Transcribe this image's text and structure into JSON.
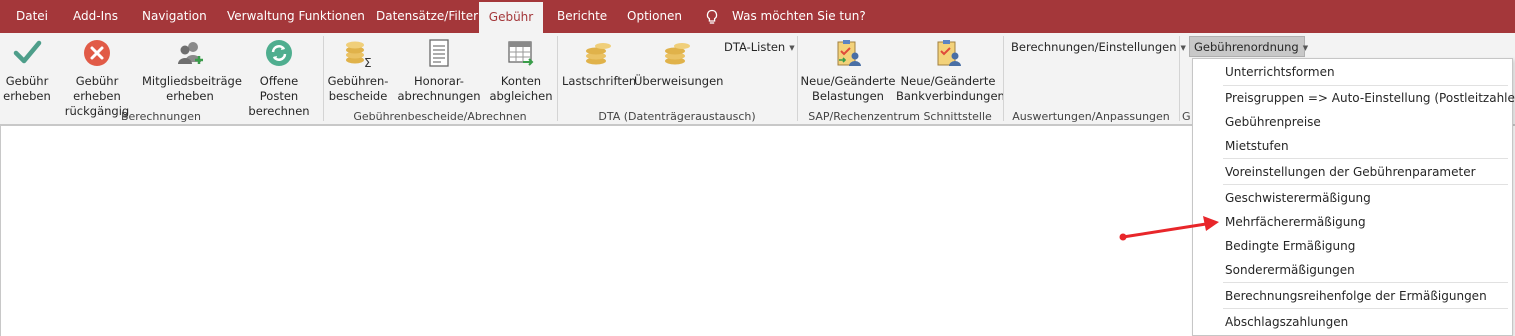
{
  "tabs": [
    "Datei",
    "Add-Ins",
    "Navigation",
    "Verwaltung Funktionen",
    "Datensätze/Filter",
    "Gebühr",
    "Berichte",
    "Optionen"
  ],
  "active_tab": "Gebühr",
  "tell_me": "Was möchten Sie tun?",
  "ribbon": {
    "buttons": {
      "gebuehr_erheben": "Gebühr\nerheben",
      "gebuehr_rueckgaengig": "Gebühr erheben\nrückgängig",
      "mitgliedsbeitraege": "Mitgliedsbeiträge\nerheben",
      "offene_posten": "Offene Posten\nberechnen",
      "gebuehrenbescheide": "Gebühren-\nbescheide",
      "honorarabrechnungen": "Honorar-\nabrechnungen",
      "konten_abgleichen": "Konten\nabgleichen",
      "lastschriften": "Lastschriften",
      "ueberweisungen": "Überweisungen",
      "neue_belastungen": "Neue/Geänderte\nBelastungen",
      "neue_bankverbindungen": "Neue/Geänderte\nBankverbindungen"
    },
    "dropdowns": {
      "dta_listen": "DTA-Listen",
      "berechnungen_einstellungen": "Berechnungen/Einstellungen",
      "gebuehrenordnung": "Gebührenordnung"
    },
    "groups": {
      "berechnungen": "Berechnungen",
      "gebuehrenbescheide": "Gebührenbescheide/Abrechnen",
      "dta": "DTA (Datenträgeraustausch)",
      "sap": "SAP/Rechenzentrum Schnittstelle",
      "auswertungen": "Auswertungen/Anpassungen",
      "g_truncated": "G"
    }
  },
  "menu_items": [
    "Unterrichtsformen",
    "Preisgruppen => Auto-Einstellung (Postleitzahlen)",
    "Gebührenpreise",
    "Mietstufen",
    "Voreinstellungen der Gebührenparameter",
    "Geschwisterermäßigung",
    "Mehrfächerermäßigung",
    "Bedingte Ermäßigung",
    "Sonderermäßigungen",
    "Berechnungsreihenfolge der Ermäßigungen",
    "Abschlagszahlungen"
  ],
  "colors": {
    "accent": "#a4373a",
    "ribbon_bg": "#f3f3f3",
    "arrow": "#e8262a"
  },
  "icons": {
    "tell_me": "lightbulb-icon",
    "gebuehr_erheben": "checkmark-icon",
    "gebuehr_rueckgaengig": "cancel-circle-icon",
    "mitgliedsbeitraege": "users-icon",
    "offene_posten": "refresh-icon",
    "gebuehrenbescheide": "coins-sum-icon",
    "honorarabrechnungen": "document-icon",
    "konten_abgleichen": "calendar-arrow-icon",
    "lastschriften": "coins-icon",
    "ueberweisungen": "coins-icon",
    "neue_belastungen": "clipboard-user-icon",
    "neue_bankverbindungen": "clipboard-user-icon"
  }
}
